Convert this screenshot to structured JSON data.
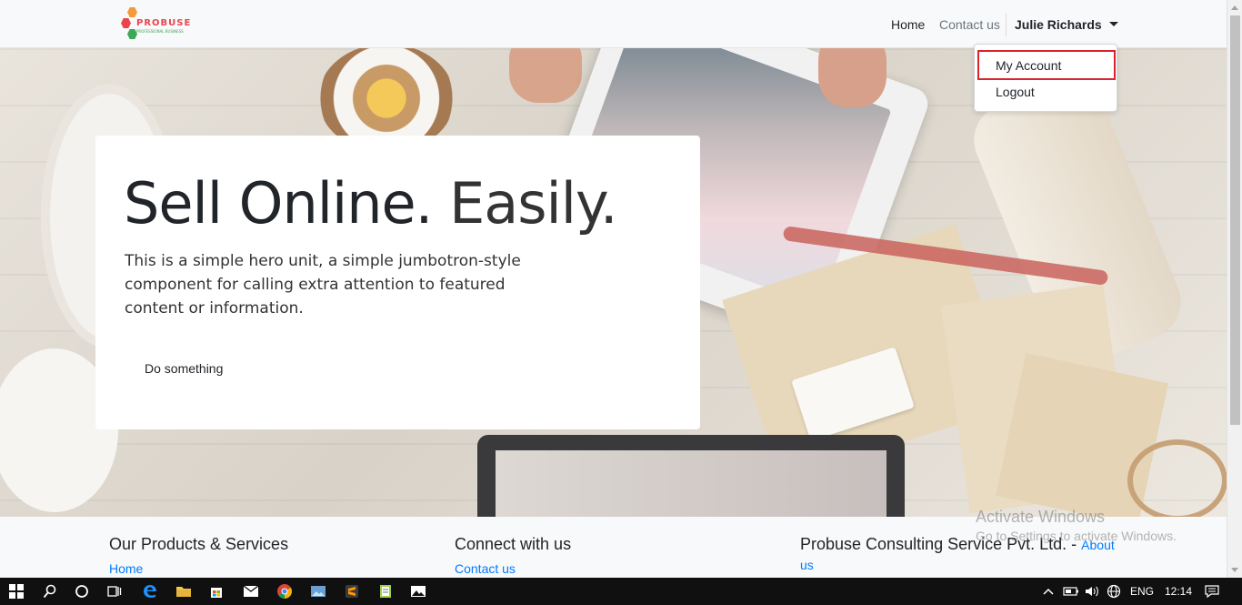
{
  "navbar": {
    "logo_text": "PROBUSE",
    "logo_subtext": "PROFESSIONAL BUSINESS",
    "home": "Home",
    "contact": "Contact us",
    "user": "Julie Richards"
  },
  "dropdown": {
    "items": [
      {
        "label": "My Account"
      },
      {
        "label": "Logout"
      }
    ]
  },
  "hero": {
    "title_strong": "Sell Online.",
    "title_light": "Easily.",
    "text": "This is a simple hero unit, a simple jumbotron-style component for calling extra attention to featured content or information.",
    "button": "Do something"
  },
  "footer": {
    "col1_heading": "Our Products & Services",
    "col1_link": "Home",
    "col2_heading": "Connect with us",
    "col2_link": "Contact us",
    "col3_heading": "Probuse Consulting Service Pvt. Ltd. -",
    "col3_link_a": "About",
    "col3_link_b": "us"
  },
  "watermark": {
    "line1": "Activate Windows",
    "line2": "Go to Settings to activate Windows."
  },
  "taskbar": {
    "language": "ENG",
    "time": "12:14"
  },
  "colors": {
    "link": "#007bff",
    "highlight": "#d9232d",
    "logo_red": "#e8454f",
    "logo_green": "#3aa857"
  }
}
